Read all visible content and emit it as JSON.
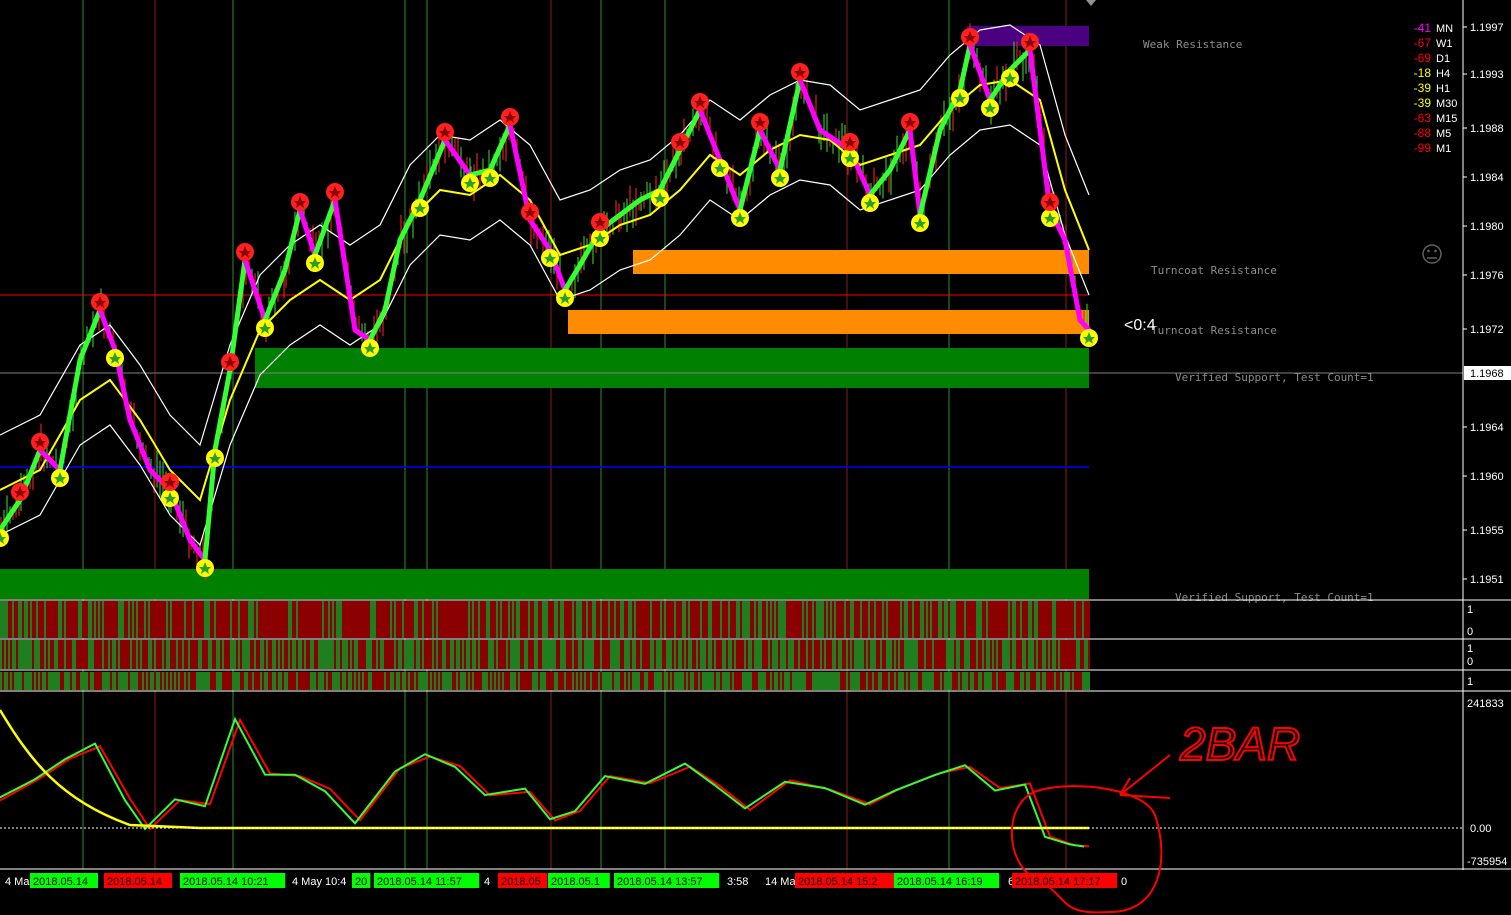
{
  "price_axis": [
    "1.1997",
    "1.1993",
    "1.1988",
    "1.1984",
    "1.1980",
    "1.1976",
    "1.1972",
    "1.1968",
    "1.1964",
    "1.1960",
    "1.1955",
    "1.1951"
  ],
  "current_price": "1.1968",
  "zones": {
    "weak_resistance": "Weak Resistance",
    "turncoat_resistance_1": "Turncoat Resistance",
    "turncoat_resistance_2": "Turncoat Resistance",
    "verified_support_1": "Verified Support, Test Count=1",
    "verified_support_2": "Verified Support, Test Count=1"
  },
  "timer": "<0:4",
  "timeframes": [
    {
      "value": "-41",
      "name": "MN",
      "color": "#ff00ff"
    },
    {
      "value": "-67",
      "name": "W1",
      "color": "#ff0000"
    },
    {
      "value": "-69",
      "name": "D1",
      "color": "#ff0000"
    },
    {
      "value": "-18",
      "name": "H4",
      "color": "#ffff00"
    },
    {
      "value": "-39",
      "name": "H1",
      "color": "#ffff00"
    },
    {
      "value": "-39",
      "name": "M30",
      "color": "#ffff00"
    },
    {
      "value": "-63",
      "name": "M15",
      "color": "#ff0000"
    },
    {
      "value": "-88",
      "name": "M5",
      "color": "#ff0000"
    },
    {
      "value": "-99",
      "name": "M1",
      "color": "#ff0000"
    }
  ],
  "subpanel_axis": {
    "p1_top": "1",
    "p1_bot": "0",
    "p2_top": "1",
    "p2_bot": "0",
    "p3": "1"
  },
  "oscillator_axis": {
    "top": "241833",
    "mid": "0.00",
    "bottom": "-735954"
  },
  "annotation": "2BAR",
  "time_axis": [
    {
      "text": "4 Ma",
      "bg": "none",
      "fg": "#ffffff"
    },
    {
      "text": "2018.05.14",
      "bg": "#00ff00",
      "fg": "#000000"
    },
    {
      "text": "2018.05.14",
      "bg": "#ff0000",
      "fg": "#000000"
    },
    {
      "text": "2018.05.14 10:21",
      "bg": "#00ff00",
      "fg": "#000000"
    },
    {
      "text": "4 May 10:4",
      "bg": "none",
      "fg": "#ffffff"
    },
    {
      "text": "20",
      "bg": "#00ff00",
      "fg": "#000000"
    },
    {
      "text": "2018.05.14 11:57",
      "bg": "#00ff00",
      "fg": "#000000"
    },
    {
      "text": "4",
      "bg": "none",
      "fg": "#ffffff"
    },
    {
      "text": "2018.05",
      "bg": "#ff0000",
      "fg": "#000000"
    },
    {
      "text": "2018.05.1",
      "bg": "#00ff00",
      "fg": "#000000"
    },
    {
      "text": "2018.05.14 13:57",
      "bg": "#00ff00",
      "fg": "#000000"
    },
    {
      "text": "3:58",
      "bg": "none",
      "fg": "#ffffff"
    },
    {
      "text": "14 Ma",
      "bg": "none",
      "fg": "#ffffff"
    },
    {
      "text": "2018.05.14 15:2",
      "bg": "#ff0000",
      "fg": "#000000"
    },
    {
      "text": "2018.05.14 16:19",
      "bg": "#00ff00",
      "fg": "#000000"
    },
    {
      "text": "6",
      "bg": "none",
      "fg": "#ffffff"
    },
    {
      "text": "2018.05.14 17:17",
      "bg": "#ff0000",
      "fg": "#000000"
    },
    {
      "text": "0",
      "bg": "none",
      "fg": "#ffffff"
    }
  ],
  "colors": {
    "background": "#000000",
    "support": "#008000",
    "resistance_orange": "#ff8c00",
    "weak_resistance": "#4b0082",
    "buy_line": "#00ff00",
    "sell_line": "#ff00ff",
    "ma": "#ffff00",
    "band": "#ffffff"
  }
}
